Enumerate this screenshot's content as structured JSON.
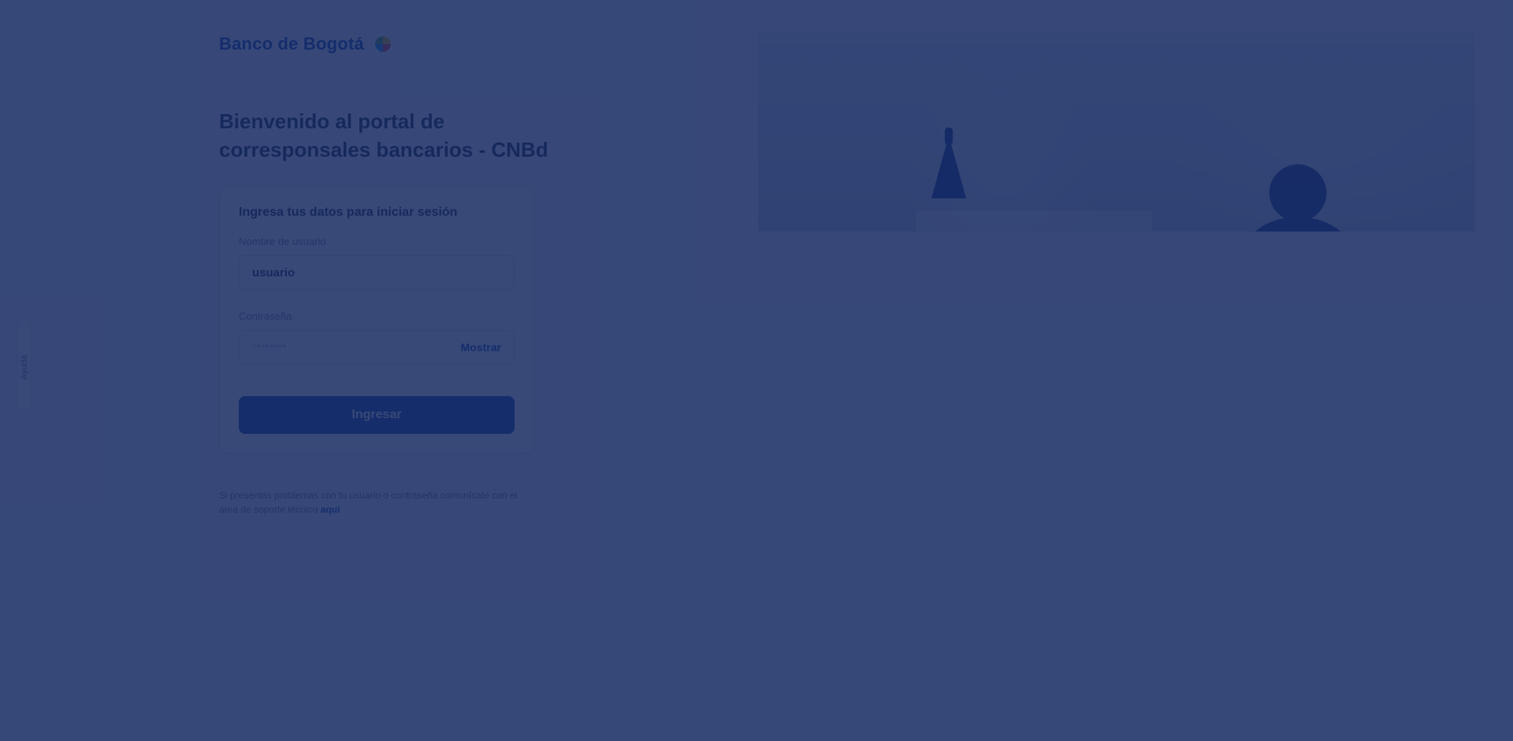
{
  "brand": {
    "name": "Banco de Bogotá",
    "mark_icon": "brand-mark-icon",
    "colors": {
      "primary": "#0b3ea8",
      "button": "#0a3a9a",
      "overlay": "#172b62"
    }
  },
  "page": {
    "title": "Bienvenido al portal de corresponsales bancarios - CNBd"
  },
  "login": {
    "card_title": "Ingresa tus datos para iniciar sesión",
    "username_label": "Nombre de usuario",
    "username_value": "usuario",
    "password_label": "Contraseña",
    "password_placeholder": "********",
    "show_label": "Mostrar",
    "submit_label": "Ingresar"
  },
  "footnote": {
    "text": "Si presentas problemas con tu usuario o contraseña comunícate con el área de soporte técnico ",
    "link_label": "aquí"
  },
  "side_tab": {
    "label": "Ayuda"
  }
}
